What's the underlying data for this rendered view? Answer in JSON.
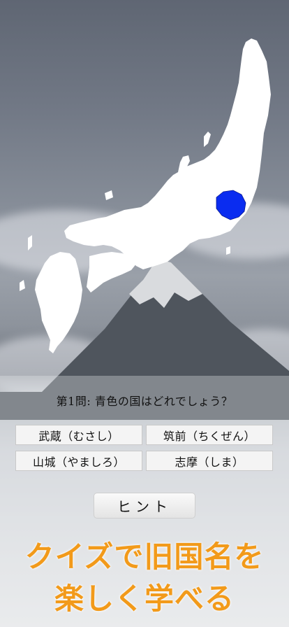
{
  "quiz": {
    "question": "第1問: 青色の国はどれでしょう？",
    "choices": [
      {
        "label": "武蔵（むさし）"
      },
      {
        "label": "筑前（ちくぜん）"
      },
      {
        "label": "山城（やましろ）"
      },
      {
        "label": "志摩（しま）"
      }
    ],
    "hint_label": "ヒント"
  },
  "map": {
    "highlight_color": "#0a2cf0",
    "land_color": "#ffffff"
  },
  "promo": {
    "line1": "クイズで旧国名を",
    "line2": "楽しく学べる",
    "color": "#f29a1a"
  }
}
